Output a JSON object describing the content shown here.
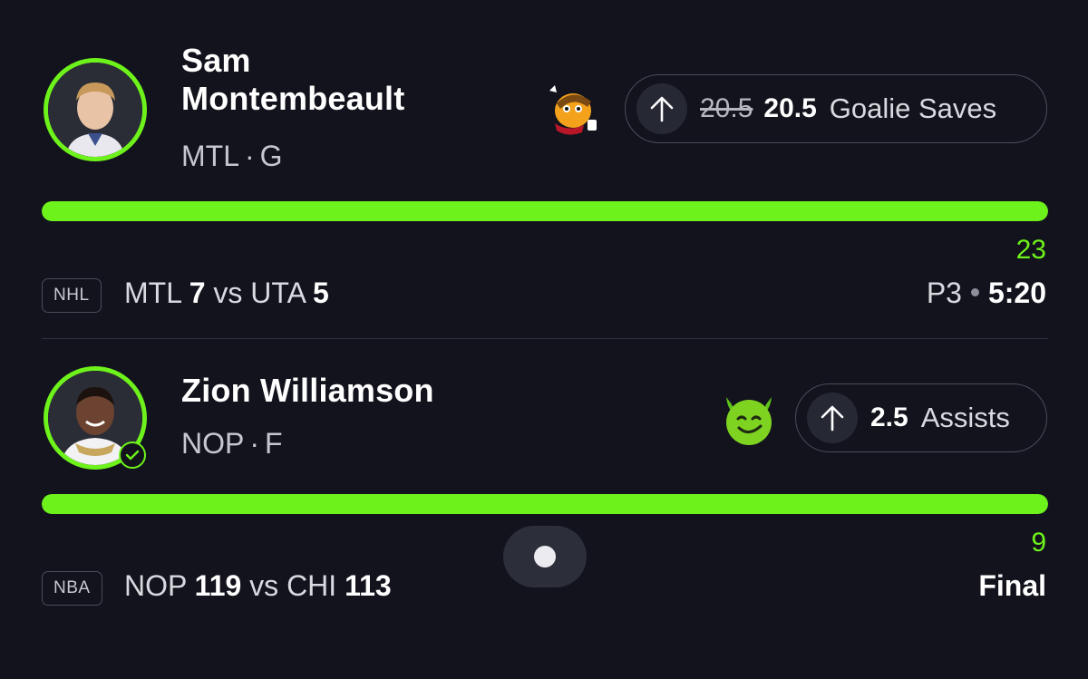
{
  "players": [
    {
      "name_line1": "Sam",
      "name_line2": "Montembeault",
      "team": "MTL",
      "position": "G",
      "old_line": "20.5",
      "line": "20.5",
      "stat_type": "Goalie Saves",
      "direction_icon": "arrow-up-icon",
      "emoji_icon": "taco-mascot-icon",
      "progress_fraction": 1.0,
      "current_value": "23",
      "league": "NHL",
      "home_team": "MTL",
      "home_score": "7",
      "vs": "vs",
      "away_team": "UTA",
      "away_score": "5",
      "period": "P3",
      "clock": "5:20",
      "status": ""
    },
    {
      "name_line1": "Zion Williamson",
      "name_line2": "",
      "team": "NOP",
      "position": "F",
      "old_line": "",
      "line": "2.5",
      "stat_type": "Assists",
      "direction_icon": "arrow-up-icon",
      "emoji_icon": "smiling-devil-icon",
      "verified_icon": "check-circle-icon",
      "progress_fraction": 1.0,
      "current_value": "9",
      "league": "NBA",
      "home_team": "NOP",
      "home_score": "119",
      "vs": "vs",
      "away_team": "CHI",
      "away_score": "113",
      "status": "Final"
    }
  ],
  "colors": {
    "accent": "#6ef21b",
    "background": "#12131c",
    "pill_border": "#4a4c58"
  }
}
